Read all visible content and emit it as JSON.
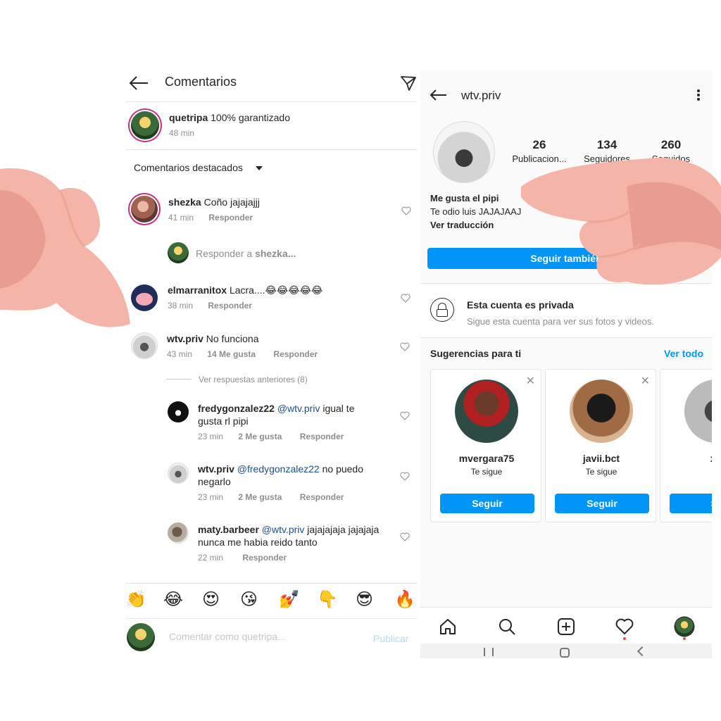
{
  "left": {
    "header": {
      "title": "Comentarios"
    },
    "caption": {
      "user": "quetripa",
      "text": "100% garantizado",
      "time": "48 min"
    },
    "filter": {
      "label": "Comentarios destacados"
    },
    "comments": [
      {
        "user": "shezka",
        "text": "Coño jajajajjj",
        "time": "41 min",
        "reply": "Responder"
      },
      {
        "user": "elmarranitox",
        "text": "Lacra....😂😂😂😂😂",
        "time": "38 min",
        "reply": "Responder"
      },
      {
        "user": "wtv.priv",
        "text": "No funciona",
        "time": "43 min",
        "likes": "14 Me gusta",
        "reply": "Responder"
      }
    ],
    "reply_prompt": {
      "prefix": "Responder a ",
      "user": "shezka..."
    },
    "view_previous": "Ver respuestas anteriores (8)",
    "replies": [
      {
        "user": "fredygonzalez22",
        "mention": "@wtv.priv",
        "text_line1": " igual te",
        "text_line2": "gusta rl pipi",
        "time": "23 min",
        "likes": "2 Me gusta",
        "reply": "Responder"
      },
      {
        "user": "wtv.priv",
        "mention": "@fredygonzalez22",
        "text_line1": " no puedo",
        "text_line2": "negarlo",
        "time": "23 min",
        "likes": "2 Me gusta",
        "reply": "Responder"
      },
      {
        "user": "maty.barbeer",
        "mention": "@wtv.priv",
        "text_line1": " jajajajaja jajajaja",
        "text_line2": "nunca me habia reido tanto",
        "time": "22 min",
        "reply": "Responder"
      }
    ],
    "emojis": [
      "👏",
      "😂",
      "😍",
      "😘",
      "💅",
      "👇",
      "😎",
      "🔥"
    ],
    "comment_bar": {
      "placeholder": "Comentar como quetripa...",
      "publish": "Publicar"
    }
  },
  "right": {
    "header": {
      "username": "wtv.priv"
    },
    "stats": [
      {
        "num": "26",
        "label": "Publicacion..."
      },
      {
        "num": "134",
        "label": "Seguidores"
      },
      {
        "num": "260",
        "label": "Seguidos"
      }
    ],
    "bio": {
      "name": "Me gusta el pipi",
      "line2": "Te odio luis JAJAJAAJ",
      "translate": "Ver traducción"
    },
    "follow_button": "Seguir también",
    "private": {
      "title": "Esta cuenta es privada",
      "subtitle": "Sigue esta cuenta para ver sus fotos y videos."
    },
    "suggestions": {
      "title": "Sugerencias para ti",
      "see_all": "Ver todo",
      "cards": [
        {
          "name": "mvergara75",
          "sub": "Te sigue",
          "button": "Seguir"
        },
        {
          "name": "javii.bct",
          "sub": "Te sigue",
          "button": "Seguir"
        },
        {
          "name": "xg",
          "sub": "Te",
          "button": "Se"
        }
      ]
    }
  },
  "colors": {
    "accent": "#0095f6",
    "text": "#262626",
    "muted": "#8e8e8e",
    "like_dot": "#ed4956",
    "hand": "#f4b5a8"
  }
}
